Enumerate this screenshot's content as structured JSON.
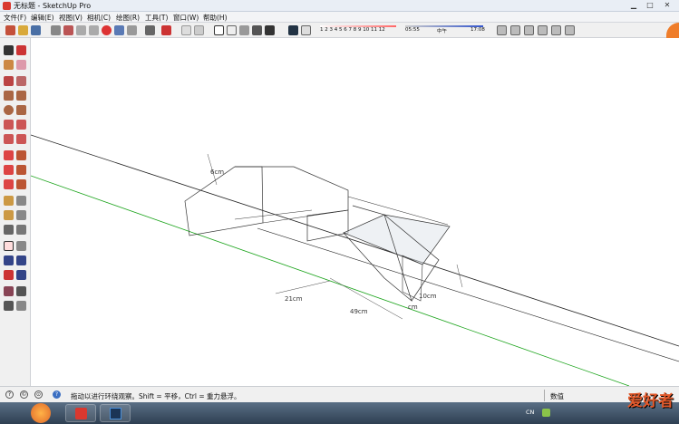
{
  "window": {
    "title": "无标题 - SketchUp Pro"
  },
  "menu": {
    "items": [
      "文件(F)",
      "编辑(E)",
      "视图(V)",
      "相机(C)",
      "绘图(R)",
      "工具(T)",
      "窗口(W)",
      "帮助(H)"
    ]
  },
  "toolbar": {
    "months": "1 2 3 4 5 6 7 8 9 10 11 12",
    "time_start": "05:55",
    "time_noon": "中午",
    "time_end": "17:08"
  },
  "model": {
    "dim_21": "21cm",
    "dim_49": "49cm",
    "dim_cm": "cm",
    "dim_10": "10cm",
    "dim_6": "6cm"
  },
  "status": {
    "message": "拖动以进行环绕观察。Shift = 平移，Ctrl = 重力悬浮。",
    "measure_label": "数值"
  },
  "taskbar": {
    "lang": "CN",
    "watermark": "爱好者"
  },
  "colors": {
    "accent_red": "#d9382f",
    "axis_green": "#1aa31a",
    "edge_black": "#222222"
  }
}
